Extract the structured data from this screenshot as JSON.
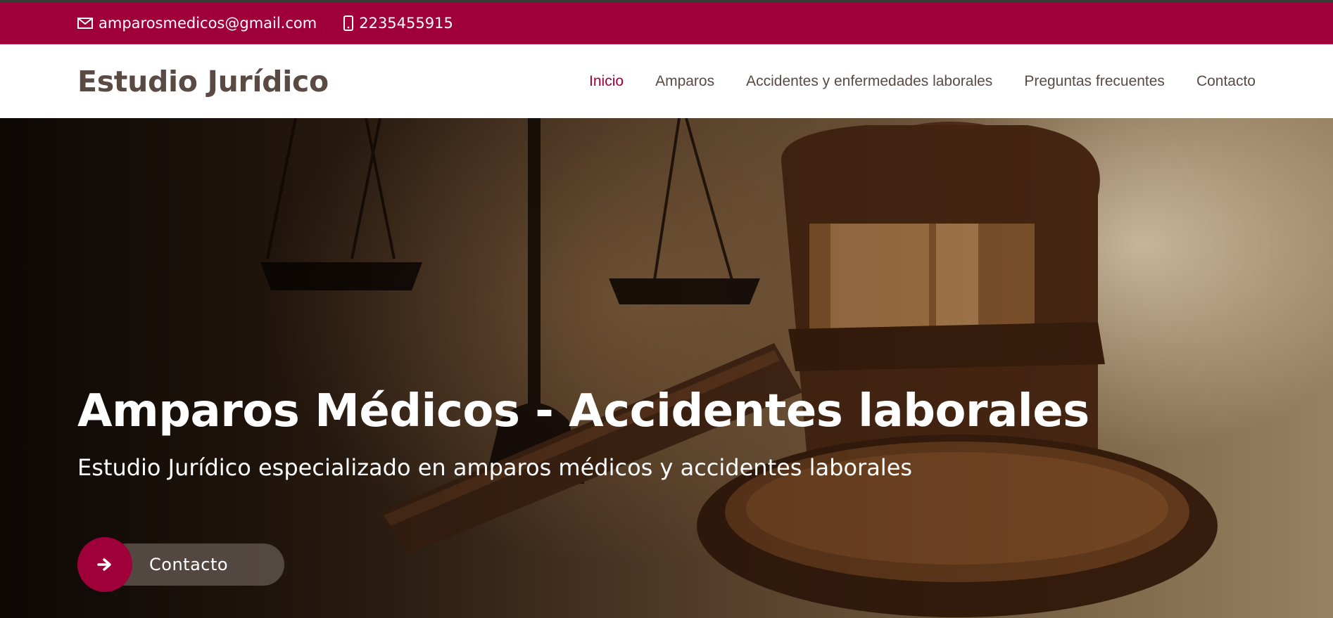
{
  "topbar": {
    "email": "amparosmedicos@gmail.com",
    "email_icon": "envelope-icon",
    "phone": "2235455915",
    "phone_icon": "mobile-phone-icon"
  },
  "header": {
    "brand": "Estudio Jurídico",
    "nav": [
      {
        "label": "Inicio",
        "active": true
      },
      {
        "label": "Amparos",
        "active": false
      },
      {
        "label": "Accidentes y enfermedades laborales",
        "active": false
      },
      {
        "label": "Preguntas frecuentes",
        "active": false
      },
      {
        "label": "Contacto",
        "active": false
      }
    ]
  },
  "hero": {
    "title": "Amparos Médicos - Accidentes laborales",
    "subtitle": "Estudio Jurídico especializado en amparos médicos y accidentes laborales",
    "cta_label": "Contacto",
    "cta_icon": "arrow-right-icon",
    "background": "gavel-and-scales-photo"
  },
  "colors": {
    "accent": "#a0003a",
    "text": "#5a4a44",
    "white": "#ffffff"
  }
}
